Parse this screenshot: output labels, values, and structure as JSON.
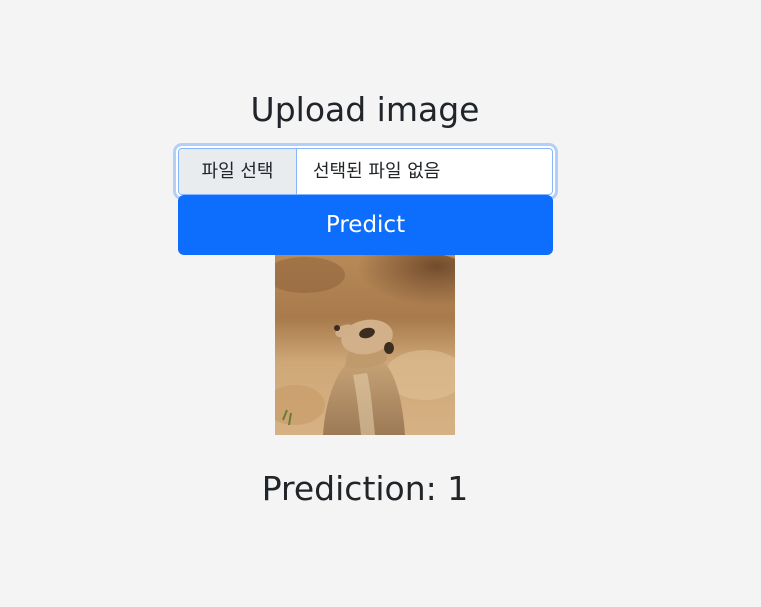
{
  "title": "Upload image",
  "file_input": {
    "button_label": "파일 선택",
    "status_text": "선택된 파일 없음"
  },
  "predict_button": {
    "label": "Predict",
    "color": "#0d6efd"
  },
  "image": {
    "subject": "meerkat"
  },
  "prediction": {
    "text": "Prediction: 1"
  }
}
